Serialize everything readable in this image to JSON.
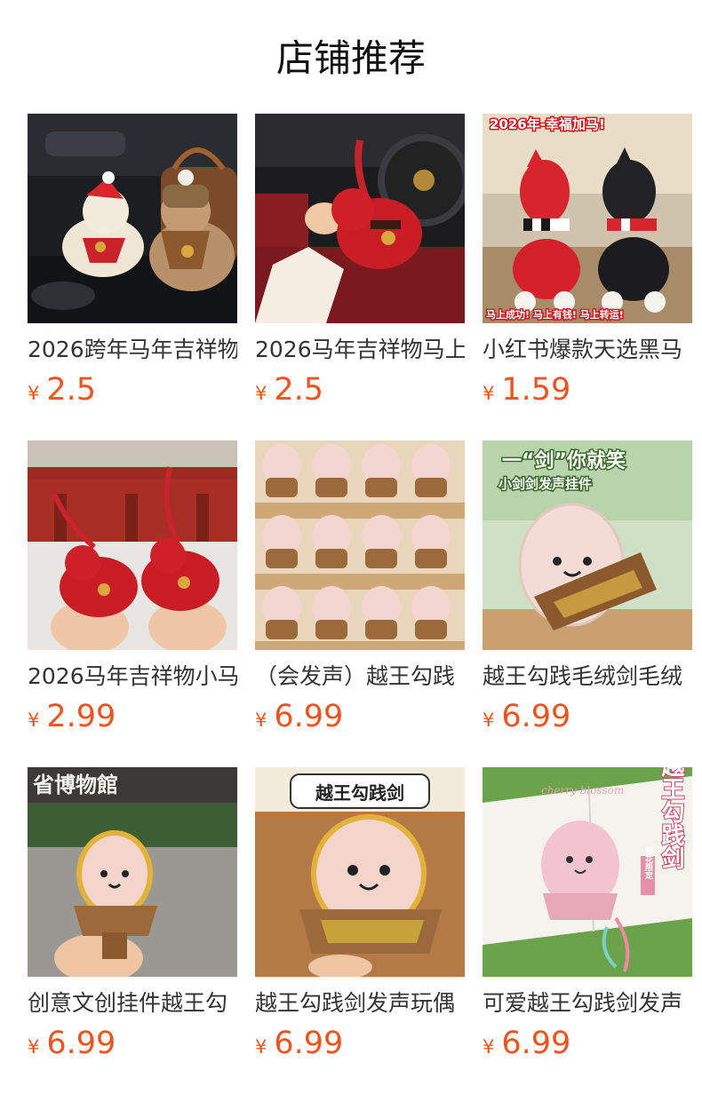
{
  "section_title": "店铺推荐",
  "currency_symbol": "¥",
  "products": [
    {
      "name": "2026跨年马年吉祥物",
      "price": "2.5",
      "image_icon": "plush-horse-car-image"
    },
    {
      "name": "2026马年吉祥物马上",
      "price": "2.5",
      "image_icon": "red-plush-horse-keychain-image",
      "image_text": []
    },
    {
      "name": "小红书爆款天选黑马",
      "price": "1.59",
      "image_icon": "red-black-horse-plush-image",
      "image_text": [
        "2026年-幸福加马!",
        "马上成功! 马上有钱! 马上转运!"
      ]
    },
    {
      "name": "2026马年吉祥物小马",
      "price": "2.99",
      "image_icon": "red-horse-pair-palace-image"
    },
    {
      "name": "（会发声）越王勾践",
      "price": "6.99",
      "image_icon": "sword-plush-shelf-image"
    },
    {
      "name": "越王勾践毛绒剑毛绒",
      "price": "6.99",
      "image_icon": "sword-plush-smile-image",
      "image_text": [
        "一“剑”你就笑",
        "小剑剑发声挂件"
      ]
    },
    {
      "name": "创意文创挂件越王勾",
      "price": "6.99",
      "image_icon": "sword-plush-museum-image",
      "image_text": [
        "省博物館"
      ]
    },
    {
      "name": "越王勾践剑发声玩偶",
      "price": "6.99",
      "image_icon": "sword-plush-closeup-image",
      "image_text": [
        "越王勾践剑"
      ]
    },
    {
      "name": "可爱越王勾践剑发声",
      "price": "6.99",
      "image_icon": "pink-sword-plush-book-image",
      "image_text": [
        "越王勾践剑",
        "樱花限定",
        "cherry blossom"
      ]
    }
  ]
}
